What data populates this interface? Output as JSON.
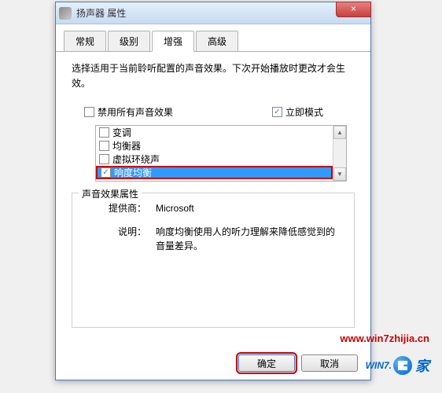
{
  "window": {
    "title": "扬声器 属性",
    "close": "×"
  },
  "tabs": [
    "常规",
    "级别",
    "增强",
    "高级"
  ],
  "activeTab": 2,
  "description": "选择适用于当前聆听配置的声音效果。下次开始播放时更改才会生效。",
  "options": {
    "disableAll": "禁用所有声音效果",
    "immediateMode": "立即模式"
  },
  "effectsList": [
    {
      "label": "变调",
      "checked": false,
      "selected": false
    },
    {
      "label": "均衡器",
      "checked": false,
      "selected": false
    },
    {
      "label": "虚拟环绕声",
      "checked": false,
      "selected": false
    },
    {
      "label": "响度均衡",
      "checked": true,
      "selected": true
    }
  ],
  "properties": {
    "legend": "声音效果属性",
    "providerLabel": "提供商：",
    "providerValue": "Microsoft",
    "descLabel": "说明：",
    "descValue": "响度均衡使用人的听力理解来降低感觉到的音量差异。"
  },
  "buttons": {
    "ok": "确定",
    "cancel": "取消"
  },
  "watermark": {
    "url": "www.win7zhijia.cn",
    "logo": "WIN7.",
    "jia": "家"
  }
}
